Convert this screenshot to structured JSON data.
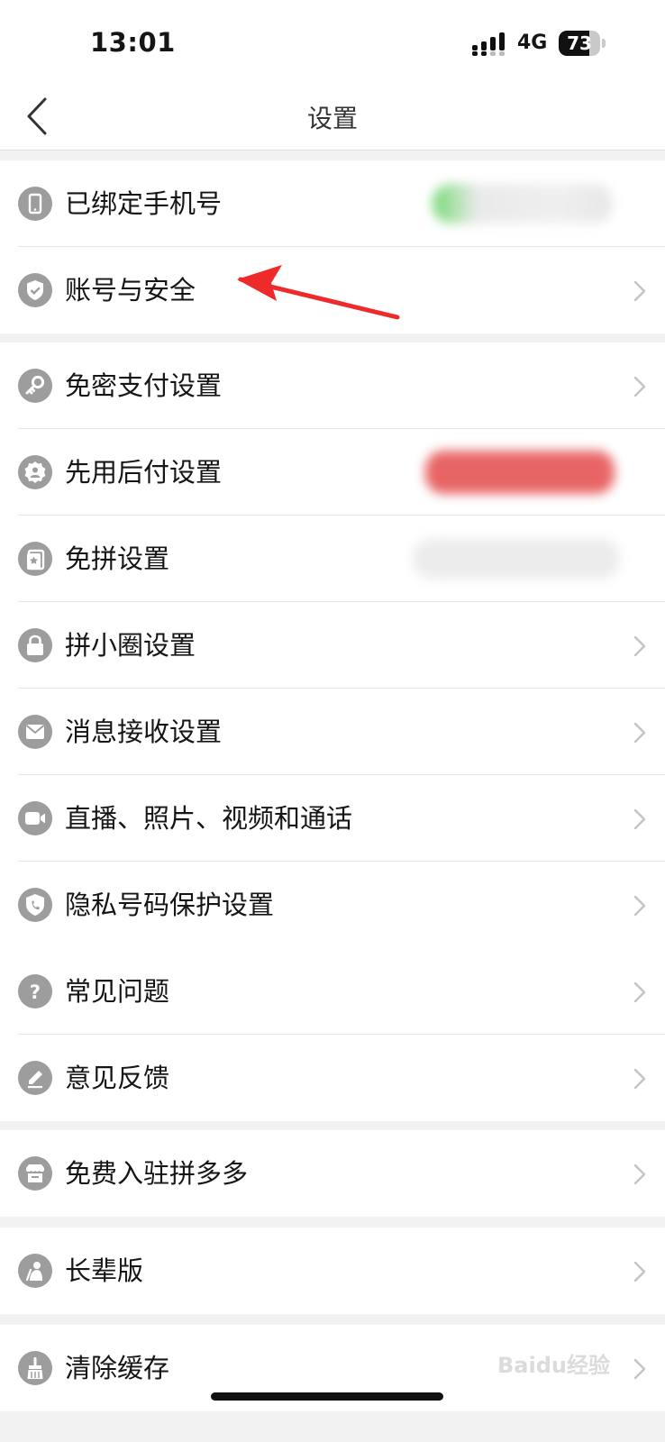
{
  "status_bar": {
    "time": "13:01",
    "network": "4G",
    "battery": "73"
  },
  "nav": {
    "title": "设置"
  },
  "groups": [
    {
      "items": [
        {
          "label": "已绑定手机号",
          "icon": "phone-icon"
        },
        {
          "label": "账号与安全",
          "icon": "shield-check-icon"
        }
      ]
    },
    {
      "items": [
        {
          "label": "免密支付设置",
          "icon": "key-icon"
        },
        {
          "label": "先用后付设置",
          "icon": "badge-person-icon"
        },
        {
          "label": "免拼设置",
          "icon": "card-star-icon"
        },
        {
          "label": "拼小圈设置",
          "icon": "lock-icon"
        },
        {
          "label": "消息接收设置",
          "icon": "envelope-icon"
        },
        {
          "label": "直播、照片、视频和通话",
          "icon": "video-camera-icon"
        },
        {
          "label": "隐私号码保护设置",
          "icon": "shield-phone-icon"
        }
      ]
    },
    {
      "items": [
        {
          "label": "常见问题",
          "icon": "question-icon"
        },
        {
          "label": "意见反馈",
          "icon": "pencil-icon"
        }
      ]
    },
    {
      "items": [
        {
          "label": "免费入驻拼多多",
          "icon": "store-icon"
        }
      ]
    },
    {
      "items": [
        {
          "label": "长辈版",
          "icon": "elder-icon"
        }
      ]
    },
    {
      "items": [
        {
          "label": "清除缓存",
          "icon": "broom-icon"
        }
      ]
    }
  ],
  "watermark": "Baidu经验",
  "colors": {
    "icon_gray": "#9d9d9d",
    "annotation_red": "#ee2a2a",
    "blur_green": "#5fd35f",
    "blur_red": "#e65555"
  }
}
